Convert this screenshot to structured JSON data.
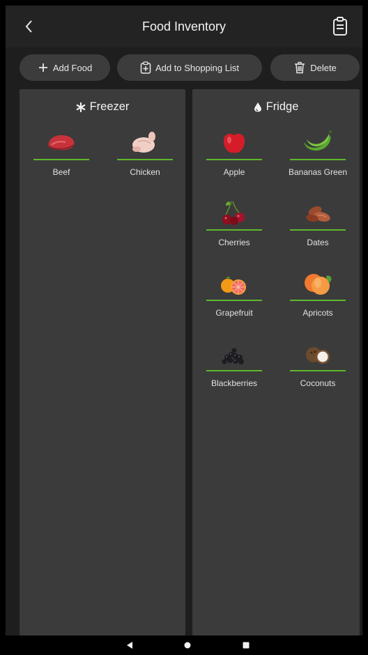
{
  "header": {
    "title": "Food Inventory"
  },
  "toolbar": {
    "add_label": "Add Food",
    "shop_label": "Add to Shopping List",
    "delete_label": "Delete"
  },
  "freezer": {
    "title": "Freezer",
    "items": [
      {
        "label": "Beef"
      },
      {
        "label": "Chicken"
      }
    ]
  },
  "fridge": {
    "title": "Fridge",
    "items": [
      {
        "label": "Apple"
      },
      {
        "label": "Bananas Green"
      },
      {
        "label": "Cherries"
      },
      {
        "label": "Dates"
      },
      {
        "label": "Grapefruit"
      },
      {
        "label": "Apricots"
      },
      {
        "label": "Blackberries"
      },
      {
        "label": "Coconuts"
      }
    ]
  },
  "colors": {
    "accent": "#5fb82d",
    "panel": "#3b3b3b",
    "background": "#1e1e1e"
  },
  "icons": {
    "back": "chevron-left-icon",
    "clipboard": "clipboard-icon",
    "add": "plus-icon",
    "shopping": "clipboard-plus-icon",
    "delete": "trash-icon",
    "freezer": "snowflake-icon",
    "fridge": "droplet-icon"
  }
}
